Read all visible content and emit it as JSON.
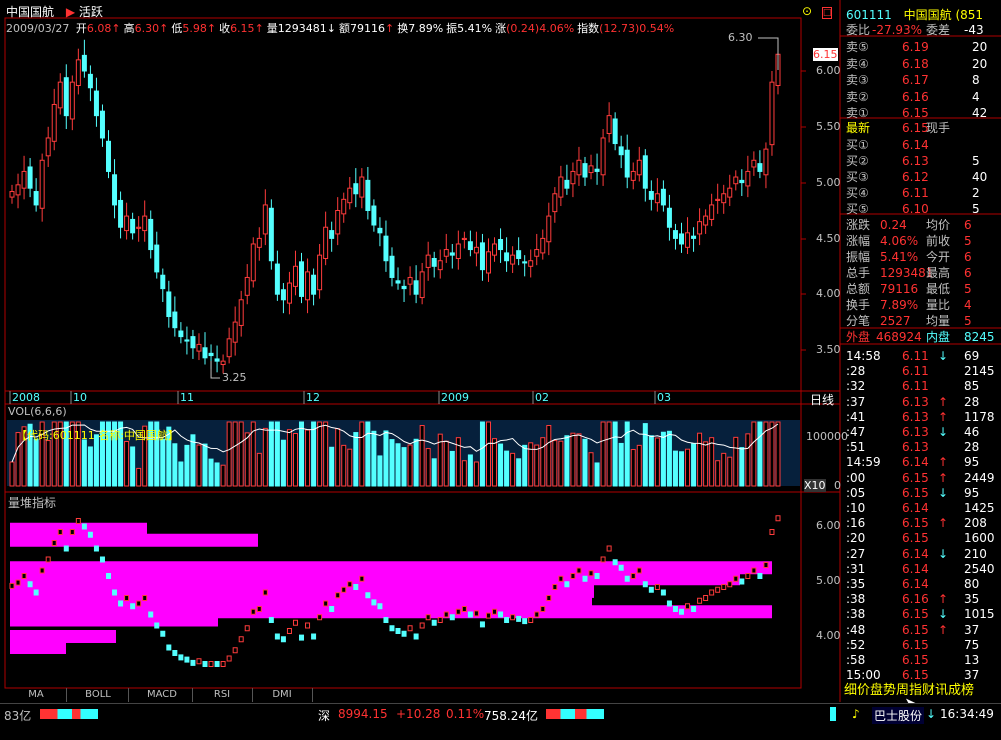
{
  "header": {
    "name": "中国国航",
    "tag": "活跃",
    "date": "2009/03/27",
    "stats": [
      {
        "label": "开",
        "value": "6.08",
        "arrow": "↑",
        "color": "red"
      },
      {
        "label": "高",
        "value": "6.30",
        "arrow": "↑",
        "color": "red"
      },
      {
        "label": "低",
        "value": "5.98",
        "arrow": "↑",
        "color": "red"
      },
      {
        "label": "收",
        "value": "6.15",
        "arrow": "↑",
        "color": "red"
      },
      {
        "label": "量",
        "value": "1293481",
        "arrow": "↓",
        "color": "white"
      },
      {
        "label": "额",
        "value": "79116",
        "arrow": "↑",
        "color": "white"
      },
      {
        "label": "换",
        "value": "7.89%",
        "arrow": "",
        "color": "white"
      },
      {
        "label": "振",
        "value": "5.41%",
        "arrow": "",
        "color": "white"
      },
      {
        "label": "涨",
        "value": "(0.24)4.06%",
        "arrow": "",
        "color": "red"
      },
      {
        "label": "指数",
        "value": "(12.73)0.54%",
        "arrow": "",
        "color": "red"
      }
    ]
  },
  "price_axis": [
    "6.00",
    "5.50",
    "5.00",
    "4.50",
    "4.00",
    "3.50"
  ],
  "price_tag": "6.15",
  "high_label": "6.30",
  "low_label": "3.25",
  "date_axis": [
    {
      "label": "2008"
    },
    {
      "label": "10"
    },
    {
      "label": "11"
    },
    {
      "label": "12"
    },
    {
      "label": "2009"
    },
    {
      "label": "02"
    },
    {
      "label": "03"
    }
  ],
  "period": "日线",
  "vol": {
    "title": "VOL(6,6,6)",
    "code_label": "【代码:601111 名称:中国国航】",
    "axis": [
      "100000",
      "0"
    ],
    "unit": "X10"
  },
  "stack": {
    "title": "量堆指标",
    "axis": [
      "6.00",
      "5.00",
      "4.00"
    ]
  },
  "tabs": [
    "MA",
    "BOLL",
    "MACD",
    "RSI",
    "DMI"
  ],
  "quote": {
    "code": "601111",
    "name": "中国国航",
    "name_extra": "(851",
    "wei_bi_label": "委比",
    "wei_bi": "-27.93%",
    "wei_cha_label": "委差",
    "wei_cha": "-43",
    "asks": [
      {
        "label": "卖⑤",
        "price": "6.19",
        "vol": "20"
      },
      {
        "label": "卖④",
        "price": "6.18",
        "vol": "20"
      },
      {
        "label": "卖③",
        "price": "6.17",
        "vol": "8"
      },
      {
        "label": "卖②",
        "price": "6.16",
        "vol": "4"
      },
      {
        "label": "卖①",
        "price": "6.15",
        "vol": "42"
      }
    ],
    "last_label": "最新",
    "last": "6.15",
    "now_hand_label": "现手",
    "bids": [
      {
        "label": "买①",
        "price": "6.14",
        "vol": ""
      },
      {
        "label": "买②",
        "price": "6.13",
        "vol": "5"
      },
      {
        "label": "买③",
        "price": "6.12",
        "vol": "40"
      },
      {
        "label": "买④",
        "price": "6.11",
        "vol": "2"
      },
      {
        "label": "买⑤",
        "price": "6.10",
        "vol": "5"
      }
    ],
    "stats": [
      {
        "l1": "涨跌",
        "v1": "0.24",
        "l2": "均价",
        "v2": "6"
      },
      {
        "l1": "涨幅",
        "v1": "4.06%",
        "l2": "前收",
        "v2": "5"
      },
      {
        "l1": "振幅",
        "v1": "5.41%",
        "l2": "今开",
        "v2": "6"
      },
      {
        "l1": "总手",
        "v1": "1293481",
        "l2": "最高",
        "v2": "6"
      },
      {
        "l1": "总额",
        "v1": "79116",
        "l2": "最低",
        "v2": "5"
      },
      {
        "l1": "换手",
        "v1": "7.89%",
        "l2": "量比",
        "v2": "4"
      },
      {
        "l1": "分笔",
        "v1": "2527",
        "l2": "均量",
        "v2": "5"
      }
    ],
    "outer_label": "外盘",
    "outer": "468924",
    "inner_label": "内盘",
    "inner": "8245"
  },
  "ticks": [
    {
      "time": "14:58",
      "price": "6.11",
      "arrow": "↓",
      "vol": "69"
    },
    {
      "time": ":28",
      "price": "6.11",
      "arrow": "",
      "vol": "2145"
    },
    {
      "time": ":32",
      "price": "6.11",
      "arrow": "",
      "vol": "85"
    },
    {
      "time": ":37",
      "price": "6.13",
      "arrow": "↑",
      "vol": "28"
    },
    {
      "time": ":41",
      "price": "6.13",
      "arrow": "↑",
      "vol": "1178"
    },
    {
      "time": ":47",
      "price": "6.13",
      "arrow": "↓",
      "vol": "46"
    },
    {
      "time": ":51",
      "price": "6.13",
      "arrow": "",
      "vol": "28"
    },
    {
      "time": "14:59",
      "price": "6.14",
      "arrow": "↑",
      "vol": "95"
    },
    {
      "time": ":00",
      "price": "6.15",
      "arrow": "↑",
      "vol": "2449"
    },
    {
      "time": ":05",
      "price": "6.15",
      "arrow": "↓",
      "vol": "95"
    },
    {
      "time": ":10",
      "price": "6.14",
      "arrow": "",
      "vol": "1425"
    },
    {
      "time": ":16",
      "price": "6.15",
      "arrow": "↑",
      "vol": "208"
    },
    {
      "time": ":20",
      "price": "6.15",
      "arrow": "",
      "vol": "1600"
    },
    {
      "time": ":27",
      "price": "6.14",
      "arrow": "↓",
      "vol": "210"
    },
    {
      "time": ":31",
      "price": "6.14",
      "arrow": "",
      "vol": "2540"
    },
    {
      "time": ":35",
      "price": "6.14",
      "arrow": "",
      "vol": "80"
    },
    {
      "time": ":38",
      "price": "6.16",
      "arrow": "↑",
      "vol": "35"
    },
    {
      "time": ":38",
      "price": "6.15",
      "arrow": "↓",
      "vol": "1015"
    },
    {
      "time": ":48",
      "price": "6.15",
      "arrow": "↑",
      "vol": "37"
    },
    {
      "time": ":52",
      "price": "6.15",
      "arrow": "",
      "vol": "75"
    },
    {
      "time": ":58",
      "price": "6.15",
      "arrow": "",
      "vol": "13"
    },
    {
      "time": "15:00",
      "price": "6.15",
      "arrow": "",
      "vol": "37"
    }
  ],
  "right_tabs": "细价盘势周指财讯成榜",
  "status": {
    "left": "83亿",
    "index_name": "深",
    "index_value": "8994.15",
    "index_change": "+10.28",
    "index_pct": "0.11%",
    "index_amount": "758.24亿",
    "ticker_text": "巴士股份",
    "clock": "16:34:49"
  },
  "chart_data": {
    "type": "candlestick",
    "security": "中国国航",
    "period": "日线",
    "y_axis": [
      3.5,
      6.0
    ],
    "closes": [
      4.92,
      4.98,
      5.1,
      4.95,
      4.8,
      5.2,
      5.4,
      5.7,
      5.9,
      5.6,
      5.9,
      6.1,
      6.0,
      5.85,
      5.6,
      5.4,
      5.1,
      4.8,
      4.6,
      4.7,
      4.55,
      4.6,
      4.7,
      4.4,
      4.2,
      4.05,
      3.8,
      3.7,
      3.62,
      3.58,
      3.52,
      3.55,
      3.43,
      3.45,
      3.4,
      3.4,
      3.6,
      3.75,
      3.95,
      4.15,
      4.45,
      4.5,
      4.8,
      4.3,
      4.0,
      3.95,
      4.1,
      4.25,
      3.98,
      4.2,
      4.0,
      4.35,
      4.6,
      4.5,
      4.75,
      4.85,
      4.95,
      4.9,
      5.05,
      4.75,
      4.62,
      4.55,
      4.3,
      4.15,
      4.1,
      4.05,
      4.15,
      4.0,
      4.2,
      4.35,
      4.25,
      4.3,
      4.4,
      4.35,
      4.45,
      4.5,
      4.4,
      4.42,
      4.22,
      4.38,
      4.45,
      4.4,
      4.3,
      4.35,
      4.32,
      4.28,
      4.3,
      4.4,
      4.5,
      4.7,
      4.9,
      5.05,
      4.95,
      5.1,
      5.2,
      5.05,
      5.15,
      5.1,
      5.4,
      5.6,
      5.35,
      5.25,
      5.05,
      5.1,
      5.2,
      4.95,
      4.85,
      4.9,
      4.8,
      4.6,
      4.5,
      4.45,
      4.55,
      4.5,
      4.65,
      4.7,
      4.8,
      4.85,
      4.9,
      4.95,
      5.05,
      5.0,
      5.1,
      5.2,
      5.1,
      5.3,
      5.9,
      6.15
    ],
    "vol_ma": "VOL(6,6,6)"
  }
}
